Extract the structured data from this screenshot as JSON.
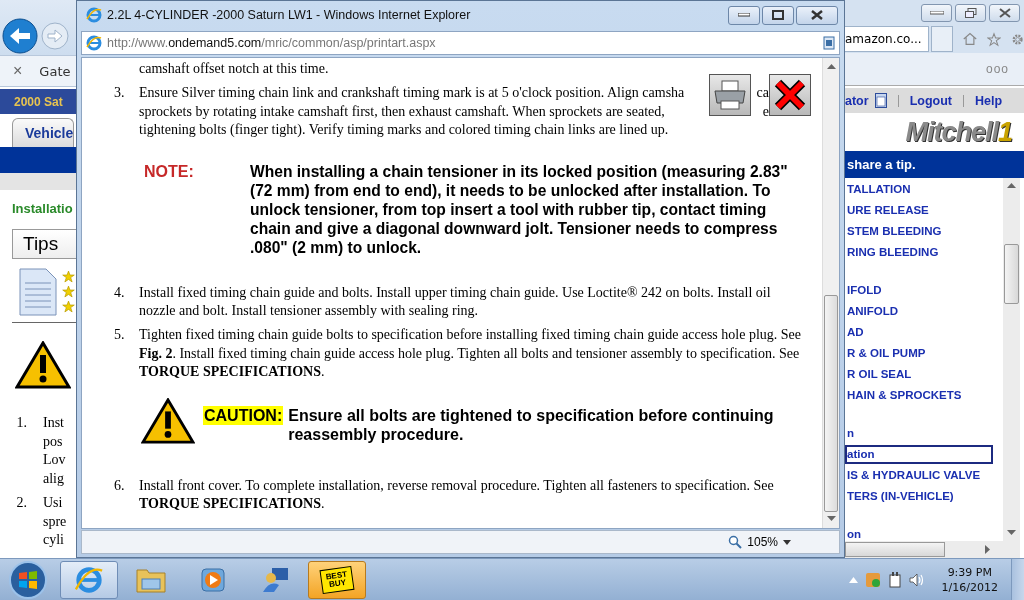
{
  "background_browser": {
    "tab_close": "×",
    "tab_label": "Gate",
    "amazon_tab": "amazon.co...",
    "menu_dots": "ooo"
  },
  "background_page": {
    "vehicle_bar": "2000 Sat",
    "tab": "Vehicle",
    "heading": "Installatio",
    "tips_label": "Tips",
    "steps": [
      {
        "number": "1.",
        "lines": [
          "Inst",
          "pos",
          "Lov",
          "alig"
        ]
      },
      {
        "number": "2.",
        "lines": [
          "Usi",
          "spre",
          "cyli"
        ]
      }
    ],
    "toolbar": {
      "partial_link": "ator",
      "links": [
        "Logout",
        "Help"
      ]
    },
    "logo": {
      "name": "Mitchell",
      "mark": "1"
    },
    "tip_banner": "share a tip.",
    "menu_groups": [
      [
        {
          "label": "TALLATION",
          "selected": false
        },
        {
          "label": "URE RELEASE",
          "selected": false
        },
        {
          "label": "STEM BLEEDING",
          "selected": false
        },
        {
          "label": "RING BLEEDING",
          "selected": false
        }
      ],
      [
        {
          "label": "IFOLD",
          "selected": false
        },
        {
          "label": "ANIFOLD",
          "selected": false
        },
        {
          "label": "AD",
          "selected": false
        },
        {
          "label": "R & OIL PUMP",
          "selected": false
        },
        {
          "label": "R OIL SEAL",
          "selected": false
        },
        {
          "label": "HAIN & SPROCKETS",
          "selected": false
        }
      ],
      [
        {
          "label": "n",
          "selected": false
        },
        {
          "label": "ation",
          "selected": true
        },
        {
          "label": "IS & HYDRAULIC VALVE",
          "selected": false
        },
        {
          "label": "TERS (IN-VEHICLE)",
          "selected": false
        }
      ],
      [
        {
          "label": "on",
          "selected": false
        }
      ]
    ]
  },
  "popup": {
    "title": "2.2L 4-CYLINDER -2000 Saturn LW1 - Windows Internet Explorer",
    "address": {
      "scheme": "http://www.",
      "host": "ondemand5.com",
      "path": "/mric/common/asp/printart.aspx"
    },
    "content": [
      {
        "kind": "text",
        "text": "camshaft offset notch at this time."
      },
      {
        "kind": "step_lines",
        "number": "3.",
        "lines": [
          {
            "text": "Ensure Silver timing chain link and crankshaft timing mark is at 5 o'clock position. Align camsha",
            "tail": "ca"
          },
          {
            "text": "sprockets by rotating intake camshaft first, then exhaust camshaft. When sprockets are seated,",
            "tail": "e"
          },
          {
            "text": "tightening bolts (finger tight). Verify timing marks and colored timing chain links are lined up."
          }
        ]
      },
      {
        "kind": "note",
        "label": "NOTE:",
        "text": "When installing a chain tensioner in its locked position (measuring 2.83\" (72 mm) from end to end), it needs to be unlocked after installation. To unlock tensioner, from top insert a tool with rubber tip, contact timing chain and give a diagonal downward jolt. Tensioner needs to compress .080\" (2 mm) to unlock."
      },
      {
        "kind": "step",
        "number": "4.",
        "text": "Install fixed timing chain guide and bolts. Install upper timing chain guide. Use Loctite® 242 on bolts. Install oil nozzle and bolt. Install tensioner assembly with sealing ring."
      },
      {
        "kind": "step",
        "number": "5.",
        "text": "Tighten fixed timing chain guide bolts to specification before installing fixed timing chain guide access hole plug. See **Fig. 2**. Install fixed timing chain guide access hole plug. Tighten all bolts and tensioner assembly to specification. See **TORQUE SPECIFICATIONS**."
      },
      {
        "kind": "caution",
        "label": "CAUTION:",
        "text": "Ensure all bolts are tightened to specification before continuing reassembly procedure."
      },
      {
        "kind": "step",
        "number": "6.",
        "text": "Install front cover. To complete installation, reverse removal procedure. Tighten all fasteners to specification. See **TORQUE SPECIFICATIONS**."
      }
    ],
    "zoom": "105%"
  },
  "taskbar": {
    "apps": [
      {
        "kind": "ie",
        "active": true
      },
      {
        "kind": "explorer",
        "active": false
      },
      {
        "kind": "media",
        "active": false
      },
      {
        "kind": "tool",
        "active": false
      },
      {
        "kind": "bestbuy",
        "active": false,
        "label": "BEST BUY"
      }
    ],
    "time": "9:39 PM",
    "date": "1/16/2012"
  }
}
